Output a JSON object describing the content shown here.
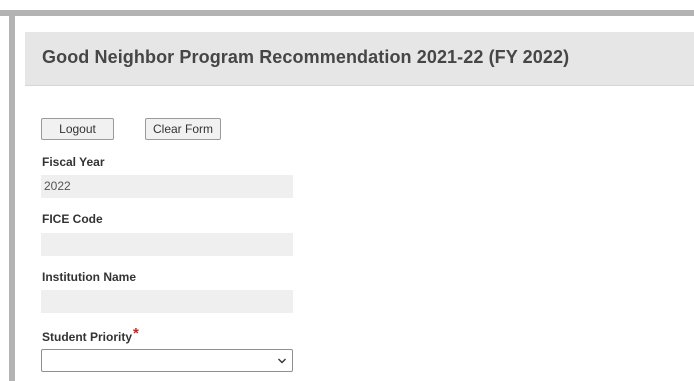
{
  "header": {
    "title": "Good Neighbor Program Recommendation 2021-22 (FY 2022)"
  },
  "toolbar": {
    "logout_label": "Logout",
    "clear_label": "Clear Form"
  },
  "form": {
    "fiscal_year": {
      "label": "Fiscal Year",
      "value": "2022"
    },
    "fice_code": {
      "label": "FICE Code",
      "value": ""
    },
    "institution_name": {
      "label": "Institution Name",
      "value": ""
    },
    "student_priority": {
      "label": "Student Priority",
      "required_mark": "*",
      "selected": ""
    }
  },
  "colors": {
    "header_bg": "#e6e6e6",
    "field_bg": "#efefef",
    "required": "#cc2222",
    "frame": "#b3b3b3"
  }
}
